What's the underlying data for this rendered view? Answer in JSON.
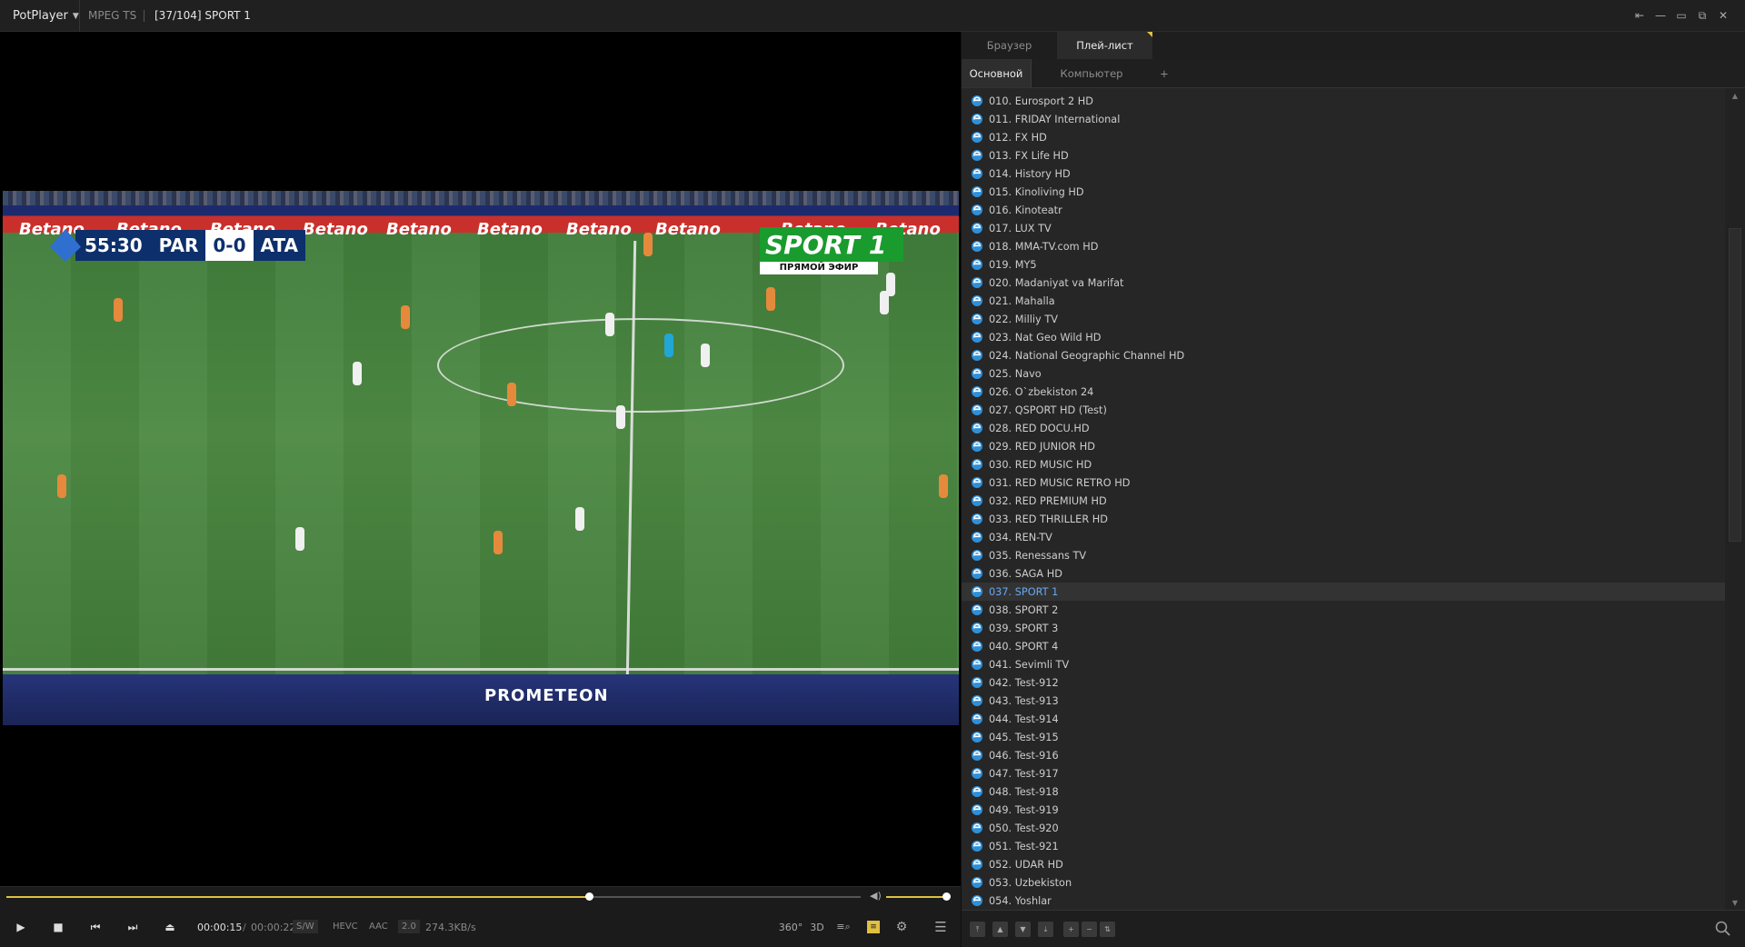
{
  "app": {
    "name": "PotPlayer",
    "format": "MPEG TS",
    "title": "[37/104] SPORT 1",
    "window_buttons": [
      "pin-icon",
      "minimize-icon",
      "restore-icon",
      "maximize-icon",
      "fullscreen-icon",
      "close-icon"
    ]
  },
  "video": {
    "scoreboard": {
      "time": "55:30",
      "home": "PAR",
      "score": "0-0",
      "away": "ATA"
    },
    "channel_logo": {
      "name": "SPORT",
      "number": "1",
      "subtitle": "ПРЯМОЙ ЭФИР"
    },
    "ad_text": [
      "Betano",
      "Betano",
      "Betano",
      "Betano",
      "Betano",
      "Betano",
      "Betano",
      "Betano",
      "Betano",
      "Betano"
    ],
    "dugout_text": "PROMETEON"
  },
  "controls": {
    "time_current": "00:00:15",
    "time_separator": "/",
    "time_total": "00:00:22",
    "decoder": "S/W",
    "video_codec": "HEVC",
    "audio_codec": "AAC",
    "channels": "2.0",
    "bitrate": "274.3KB/s",
    "seek_fraction": 0.682,
    "volume_fraction": 1.0,
    "icons": {
      "vr": "360°",
      "three_d": "3D"
    },
    "accent": "#e0c040"
  },
  "panel": {
    "tabs": [
      "Браузер",
      "Плей-лист"
    ],
    "active_tab": 1,
    "subtabs": [
      "Основной",
      "Компьютер",
      "+"
    ],
    "active_subtab": 0,
    "current_item": "037. SPORT 1",
    "current_color": "#6aa8f0",
    "items": [
      "010. Eurosport 2 HD",
      "011. FRIDAY International",
      "012. FX HD",
      "013. FX Life HD",
      "014. History HD",
      "015. Kinoliving HD",
      "016. Kinoteatr",
      "017. LUX TV",
      "018. MMA-TV.com HD",
      "019. MY5",
      "020. Madaniyat va Marifat",
      "021. Mahalla",
      "022. Milliy TV",
      "023. Nat Geo Wild HD",
      "024. National Geographic Channel HD",
      "025. Navo",
      "026. O`zbekiston 24",
      "027. QSPORT HD (Test)",
      "028. RED DOCU.HD",
      "029. RED JUNIOR HD",
      "030. RED MUSIC HD",
      "031. RED MUSIC RETRO HD",
      "032. RED PREMIUM HD",
      "033. RED THRILLER HD",
      "034. REN-TV",
      "035. Renessans TV",
      "036. SAGA HD",
      "037. SPORT 1",
      "038. SPORT 2",
      "039. SPORT 3",
      "040. SPORT 4",
      "041. Sevimli TV",
      "042. Test-912",
      "043. Test-913",
      "044. Test-914",
      "045. Test-915",
      "046. Test-916",
      "047. Test-917",
      "048. Test-918",
      "049. Test-919",
      "050. Test-920",
      "051. Test-921",
      "052. UDAR HD",
      "053. Uzbekiston",
      "054. Yoshlar"
    ],
    "bottom_buttons": [
      "⤒",
      "▲",
      "▼",
      "⤓",
      "+",
      "−",
      "⇅"
    ]
  }
}
